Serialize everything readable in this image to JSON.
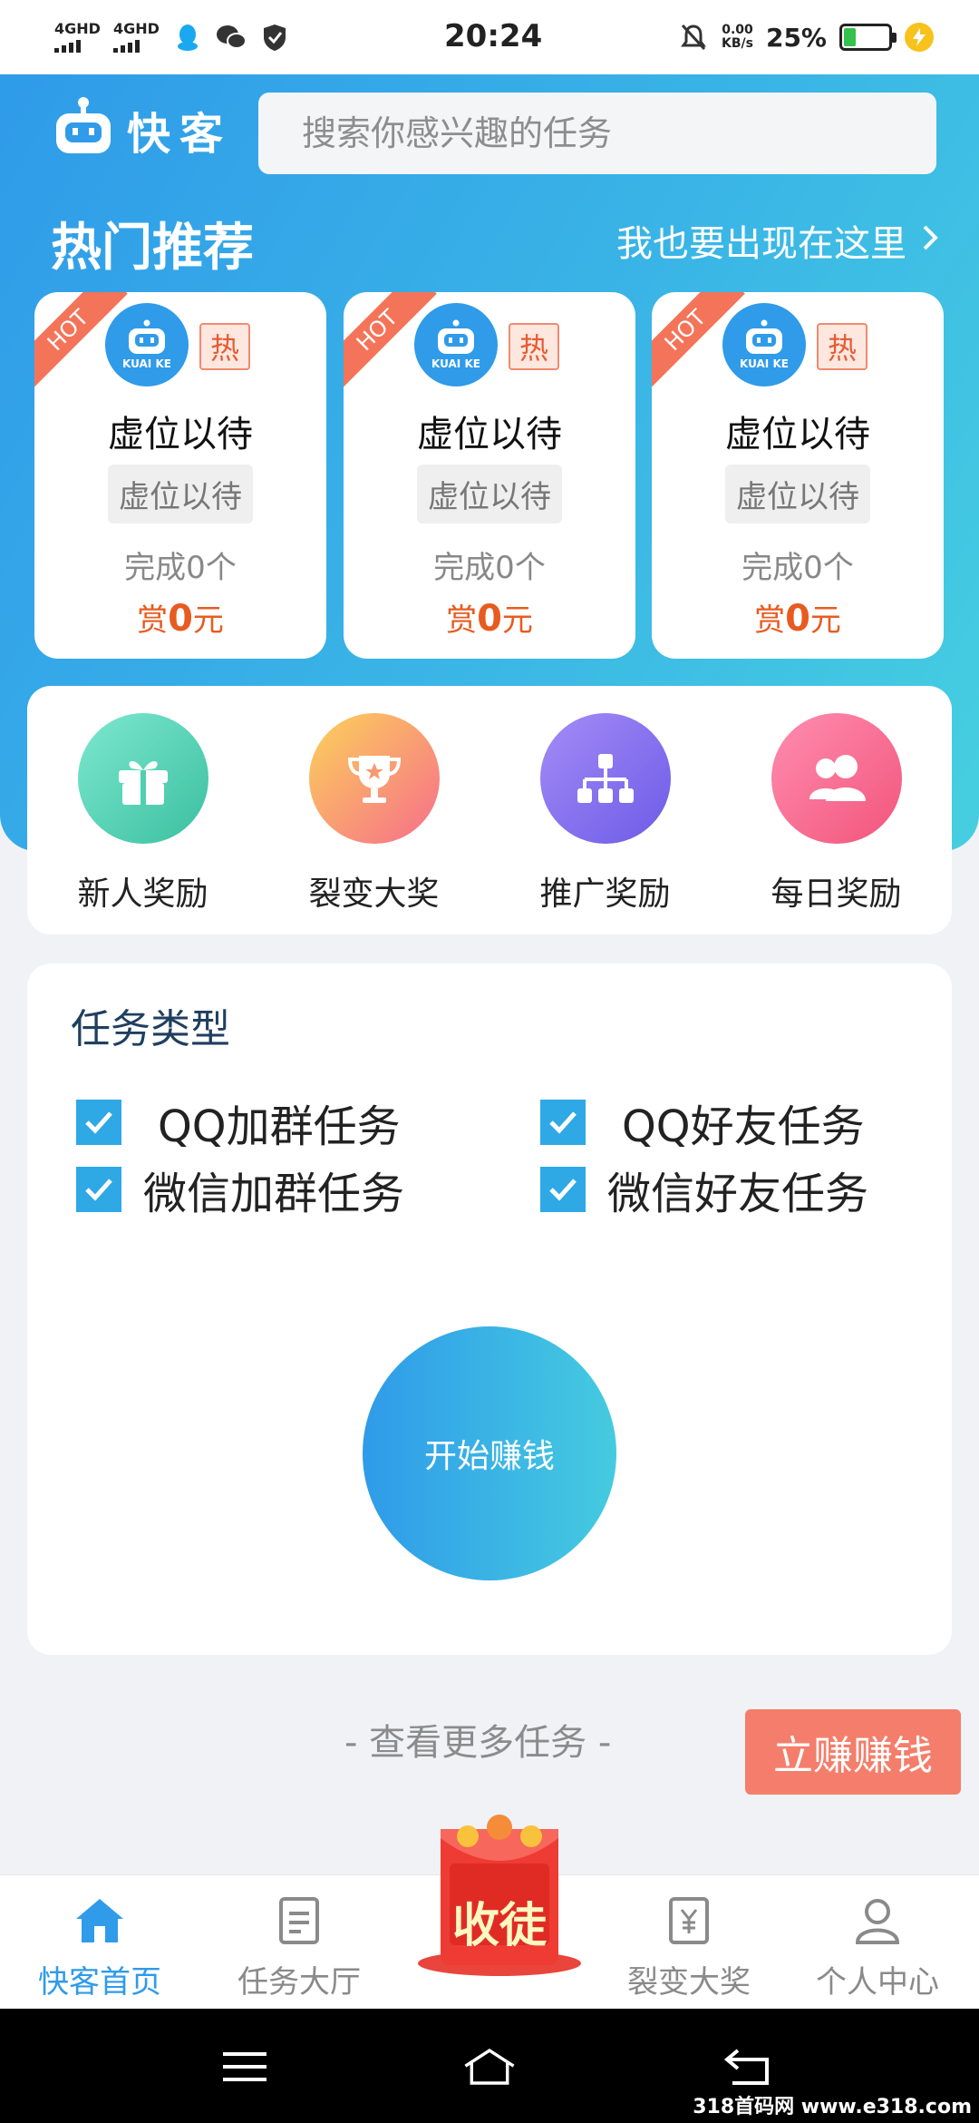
{
  "status_bar": {
    "signal1": "4GHD",
    "signal2": "4GHD",
    "time": "20:24",
    "net_speed_value": "0.00",
    "net_speed_unit": "KB/s",
    "battery": "25%"
  },
  "header": {
    "app_name": "快客",
    "search_placeholder": "搜索你感兴趣的任务",
    "section_title": "热门推荐",
    "appear_link": "我也要出现在这里"
  },
  "hot_cards": [
    {
      "ribbon": "HOT",
      "logo_label": "KUAI KE",
      "badge": "热",
      "title": "虚位以待",
      "tag": "虚位以待",
      "done_prefix": "完成",
      "done_count": "0",
      "done_suffix": "个",
      "reward_prefix": "赏",
      "reward_amount": "0",
      "reward_suffix": "元"
    },
    {
      "ribbon": "HOT",
      "logo_label": "KUAI KE",
      "badge": "热",
      "title": "虚位以待",
      "tag": "虚位以待",
      "done_prefix": "完成",
      "done_count": "0",
      "done_suffix": "个",
      "reward_prefix": "赏",
      "reward_amount": "0",
      "reward_suffix": "元"
    },
    {
      "ribbon": "HOT",
      "logo_label": "KUAI KE",
      "badge": "热",
      "title": "虚位以待",
      "tag": "虚位以待",
      "done_prefix": "完成",
      "done_count": "0",
      "done_suffix": "个",
      "reward_prefix": "赏",
      "reward_amount": "0",
      "reward_suffix": "元"
    }
  ],
  "rewards": [
    {
      "label": "新人奖励",
      "icon": "gift-icon",
      "color_from": "#6fe0c4",
      "color_to": "#3bbfa0"
    },
    {
      "label": "裂变大奖",
      "icon": "trophy-icon",
      "color_from": "#fcd25a",
      "color_to": "#f66d8b"
    },
    {
      "label": "推广奖励",
      "icon": "network-icon",
      "color_from": "#a48cf7",
      "color_to": "#6d5be6"
    },
    {
      "label": "每日奖励",
      "icon": "users-icon",
      "color_from": "#ff8db0",
      "color_to": "#f2557b"
    }
  ],
  "task_types": {
    "heading": "任务类型",
    "options": [
      {
        "label": "QQ加群任务",
        "checked": true
      },
      {
        "label": "QQ好友任务",
        "checked": true
      },
      {
        "label": "微信加群任务",
        "checked": true
      },
      {
        "label": "微信好友任务",
        "checked": true
      }
    ],
    "start_button": "开始赚钱"
  },
  "more_tasks": "- 查看更多任务 -",
  "earn_button": "立赚赚钱",
  "bottom_nav": {
    "items": [
      {
        "label": "快客首页",
        "icon": "home-icon",
        "active": true
      },
      {
        "label": "任务大厅",
        "icon": "document-icon",
        "active": false
      },
      {
        "label": "裂变大奖",
        "icon": "yen-document-icon",
        "active": false
      },
      {
        "label": "个人中心",
        "icon": "person-icon",
        "active": false
      }
    ],
    "center_label": "收徒"
  },
  "watermark": "318首码网 www.e318.com",
  "colors": {
    "brand": "#2f9be9",
    "accent": "#f47e6b",
    "reward_text": "#e85b20"
  }
}
